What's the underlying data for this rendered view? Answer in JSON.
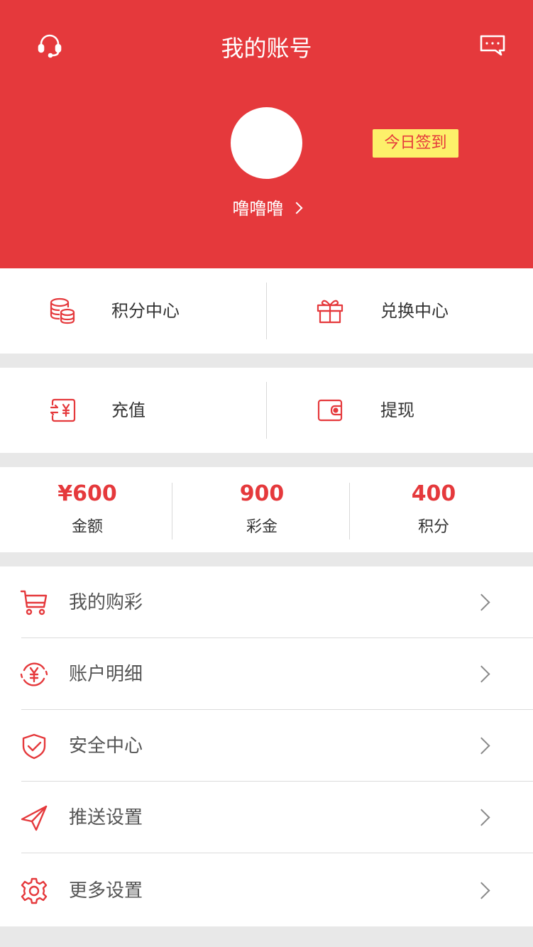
{
  "header": {
    "title": "我的账号",
    "signin_label": "今日签到",
    "username": "噜噜噜",
    "left_icon": "headset-icon",
    "right_icon": "message-icon",
    "bg_color": "#e5393c"
  },
  "grid": [
    {
      "label": "积分中心",
      "icon": "coins-stack-icon"
    },
    {
      "label": "兑换中心",
      "icon": "gift-icon"
    },
    {
      "label": "充值",
      "icon": "recharge-yen-icon"
    },
    {
      "label": "提现",
      "icon": "wallet-icon"
    }
  ],
  "stats": [
    {
      "value": "¥600",
      "label": "金额"
    },
    {
      "value": "900",
      "label": "彩金"
    },
    {
      "value": "400",
      "label": "积分"
    }
  ],
  "menu": [
    {
      "label": "我的购彩",
      "icon": "cart-icon"
    },
    {
      "label": "账户明细",
      "icon": "yen-cycle-icon"
    },
    {
      "label": "安全中心",
      "icon": "shield-check-icon"
    },
    {
      "label": "推送设置",
      "icon": "paper-plane-icon"
    },
    {
      "label": "更多设置",
      "icon": "gear-icon"
    }
  ],
  "accent_color": "#e5393c"
}
